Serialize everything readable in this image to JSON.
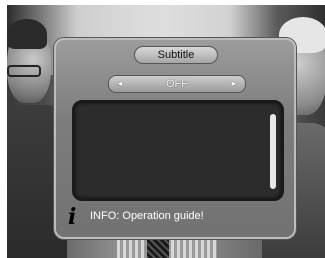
{
  "dialog": {
    "title": "Subtitle",
    "selector": {
      "value": "OFF",
      "left_arrow": "◄",
      "right_arrow": "►"
    },
    "info": {
      "icon": "info-icon",
      "text": "INFO: Operation guide!"
    }
  },
  "colors": {
    "dialog_bg": "#7d7d7d",
    "content_bg": "#2c2c2c",
    "text": "#ffffff"
  }
}
